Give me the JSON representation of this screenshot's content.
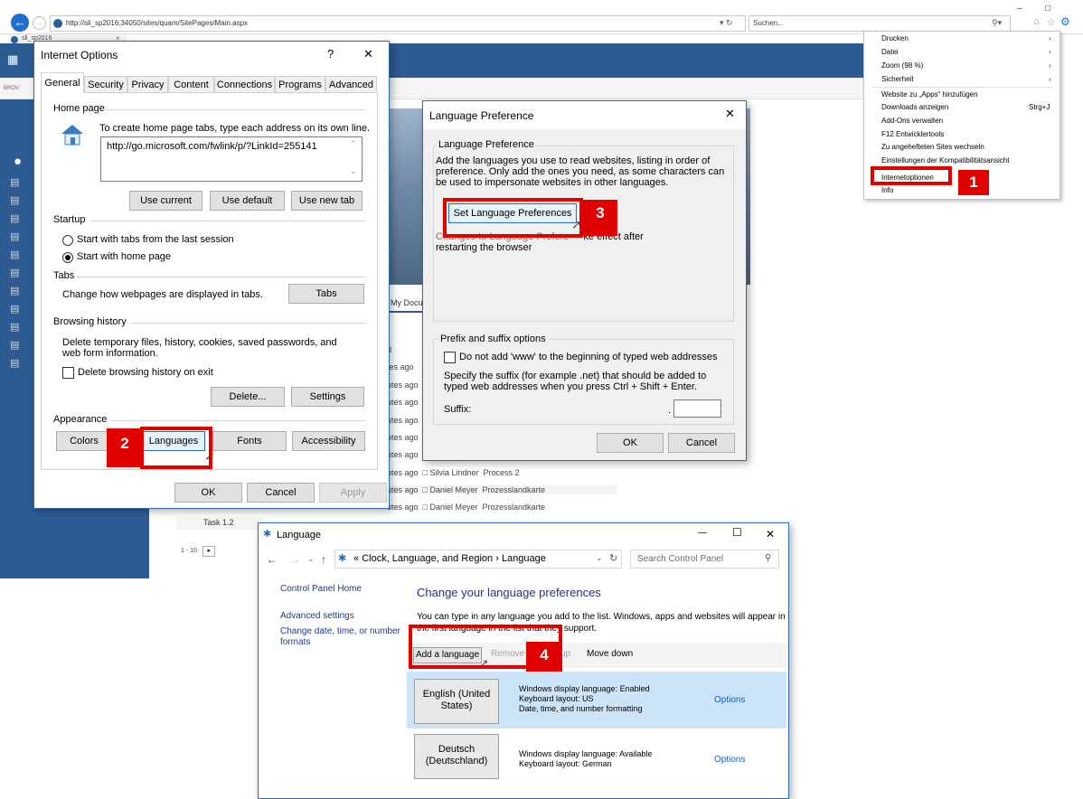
{
  "browser": {
    "url": "http://sli_sp2016:34050/sites/quam/SitePages/Main.aspx",
    "search_placeholder": "Suchen...",
    "tab_title": "sli_sp2016",
    "brow_label": "BROV"
  },
  "ie_menu": {
    "items": [
      "Drucken",
      "Datei",
      "Zoom (98 %)",
      "Sicherheit",
      "Website zu „Apps“ hinzufügen",
      "Downloads anzeigen",
      "Add-Ons verwalten",
      "F12 Entwicklertools",
      "Zu angehefteten Sites wechseln",
      "Einstellungen der Kompatibilitätsansicht",
      "Internetoptionen",
      "Info"
    ],
    "shortcut": "Strg+J",
    "badge": "1"
  },
  "internet_options": {
    "title": "Internet Options",
    "help": "?",
    "close": "✕",
    "tabs": [
      "General",
      "Security",
      "Privacy",
      "Content",
      "Connections",
      "Programs",
      "Advanced"
    ],
    "home_page_group": "Home page",
    "home_page_desc": "To create home page tabs, type each address on its own line.",
    "home_page_url": "http://go.microsoft.com/fwlink/p/?LinkId=255141",
    "use_current": "Use current",
    "use_default": "Use default",
    "use_new_tab": "Use new tab",
    "startup_group": "Startup",
    "startup_last": "Start with tabs from the last session",
    "startup_home": "Start with home page",
    "tabs_group": "Tabs",
    "tabs_desc": "Change how webpages are displayed in tabs.",
    "tabs_button": "Tabs",
    "history_group": "Browsing history",
    "history_desc": "Delete temporary files, history, cookies, saved passwords, and web form information.",
    "history_delete_exit": "Delete browsing history on exit",
    "delete_button": "Delete...",
    "settings_button": "Settings",
    "appearance_group": "Appearance",
    "colors_button": "Colors",
    "languages_button": "Languages",
    "fonts_button": "Fonts",
    "accessibility_button": "Accessibility",
    "ok": "OK",
    "cancel": "Cancel",
    "apply": "Apply",
    "badge": "2"
  },
  "language_preference": {
    "title": "Language Preference",
    "close": "✕",
    "group": "Language Preference",
    "desc": "Add the languages you use to read websites, listing in order of preference. Only add the ones you need, as some characters can be used to impersonate websites in other languages.",
    "set_button": "Set Language Preferences",
    "changes_prefix": "Changes to Language Prefere",
    "changes_suffix": "ke effect after",
    "changes_line2": "restarting the browser",
    "prefix_group": "Prefix and suffix options",
    "no_www": "Do not add 'www' to the beginning of typed web addresses",
    "suffix_desc": "Specify the suffix (for example .net) that should be added to typed web addresses when you press Ctrl + Shift + Enter.",
    "suffix_label": "Suffix:",
    "suffix_dot": ".",
    "ok": "OK",
    "cancel": "Cancel",
    "badge": "3"
  },
  "sharepoint_bg": {
    "doc_header": "My Docu",
    "rows": [
      {
        "time": "d",
        "name": "",
        "doc": ""
      },
      {
        "time": "tes ago",
        "name": "",
        "doc": ""
      },
      {
        "time": "utes ago",
        "name": "",
        "doc": ""
      },
      {
        "time": "utes ago",
        "name": "",
        "doc": ""
      },
      {
        "time": "utes ago",
        "name": "",
        "doc": ""
      },
      {
        "time": "utes ago",
        "name": "",
        "doc": ""
      },
      {
        "time": "utes ago",
        "name": "",
        "doc": ""
      },
      {
        "time": "utes ago",
        "name": "",
        "doc": ""
      },
      {
        "time": "utes ago",
        "name": "Silvia Lindner",
        "doc": "Process 2"
      },
      {
        "time": "utes ago",
        "name": "Daniel Meyer",
        "doc": "Prozesslandkarte"
      },
      {
        "time": "utes ago",
        "name": "Daniel Meyer",
        "doc": "Prozesslandkarte"
      }
    ],
    "task_label": "Task 1.2",
    "pager": "1 - 10",
    "pager_next": "▸"
  },
  "language_window": {
    "title": "Language",
    "min": "—",
    "max": "☐",
    "close": "✕",
    "breadcrumb_prefix": "«",
    "breadcrumb_1": "Clock, Language, and Region",
    "breadcrumb_sep": "›",
    "breadcrumb_2": "Language",
    "search_placeholder": "Search Control Panel",
    "side_links": [
      "Control Panel Home",
      "Advanced settings",
      "Change date, time, or number formats"
    ],
    "heading": "Change your language preferences",
    "desc_a": "You can type in any language you add to the list. Windows, apps and websites will appear in",
    "desc_b": "the first language in the list that they support.",
    "toolbar": [
      "Add a language",
      "Remove",
      "up",
      "Move down"
    ],
    "languages": [
      {
        "name": "English (United States)",
        "info": [
          "Windows display language: Enabled",
          "Keyboard layout: US",
          "Date, time, and number formatting"
        ],
        "options": "Options"
      },
      {
        "name": "Deutsch (Deutschland)",
        "info": [
          "Windows display language: Available",
          "Keyboard layout: German"
        ],
        "options": "Options"
      }
    ],
    "badge": "4"
  }
}
